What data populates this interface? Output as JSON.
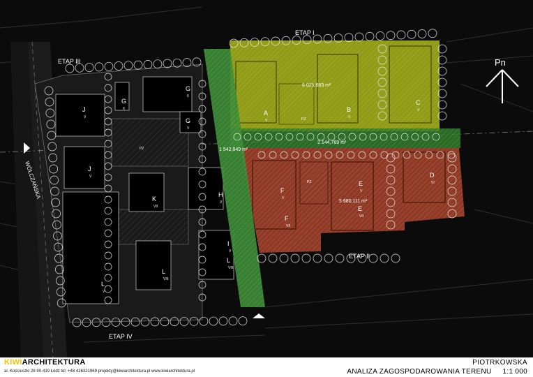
{
  "stages": {
    "etap1": "ETAP I",
    "etap2": "ETAP II",
    "etap3": "ETAP III",
    "etap4": "ETAP IV"
  },
  "areas": {
    "yellow": "6 025,663 m²",
    "green": "2 144,789 m²",
    "red": "5 680,111 m²",
    "road": "1 542,849 m²"
  },
  "street": "WÓLCZAŃSKA",
  "north_label": "Pn",
  "pz": "PZ",
  "buildings": [
    {
      "letter": "A",
      "floors": "V"
    },
    {
      "letter": "B",
      "floors": "V"
    },
    {
      "letter": "C",
      "floors": "V"
    },
    {
      "letter": "D",
      "floors": "VI"
    },
    {
      "letter": "E",
      "floors": "V"
    },
    {
      "letter": "E",
      "floors": "VII"
    },
    {
      "letter": "F",
      "floors": "V"
    },
    {
      "letter": "F",
      "floors": "VII"
    },
    {
      "letter": "G",
      "floors": "II"
    },
    {
      "letter": "G",
      "floors": "II"
    },
    {
      "letter": "G",
      "floors": "V"
    },
    {
      "letter": "H",
      "floors": "V"
    },
    {
      "letter": "I",
      "floors": "V"
    },
    {
      "letter": "J",
      "floors": "V"
    },
    {
      "letter": "J",
      "floors": "V"
    },
    {
      "letter": "K",
      "floors": "VII"
    },
    {
      "letter": "L",
      "floors": "VIII"
    },
    {
      "letter": "L",
      "floors": "VIII"
    },
    {
      "letter": "L",
      "floors": "V"
    }
  ],
  "footer": {
    "brand_kiwi": "KIWI",
    "brand_arch": "ARCHITEKTURA",
    "contact": "al. Kościuszki 28 90-419 Łódź    tel: +48 426321969    projekty@kiwiarchitektura.pl    www.kiwiarchitektura.pl",
    "project": "PIOTRKOWSKA",
    "sheet_title": "ANALIZA ZAGOSPODAROWANIA TERENU",
    "scale": "1:1 000"
  }
}
